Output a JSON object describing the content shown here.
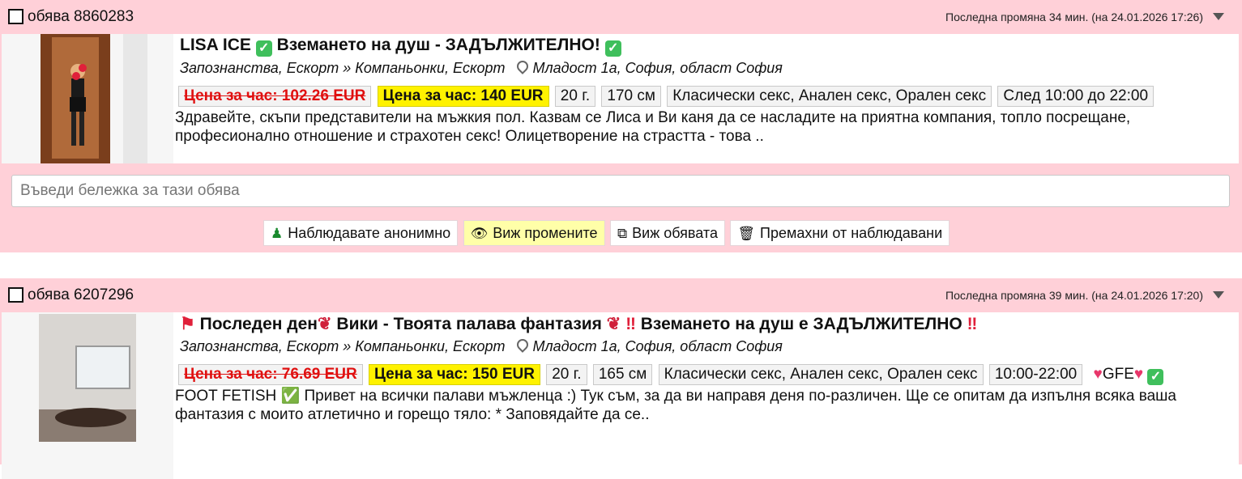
{
  "listings": [
    {
      "ad_id": "обява 8860283",
      "updated": "Последна промяна 34 мин. (на 24.01.2026 17:26)",
      "title_name": "LISA ICE",
      "title_rest": "Вземането на душ - ЗАДЪЛЖИТЕЛНО!",
      "category": "Запознанства, Ескорт » Компаньонки, Ескорт",
      "location": "Младост 1а, София, област София",
      "old_price": "Цена за час: 102.26 EUR",
      "new_price": "Цена за час: 140 EUR",
      "age": "20 г.",
      "height": "170 см",
      "services": "Класически секс, Анален секс, Орален секс",
      "hours": "След 10:00 до 22:00",
      "description": "Здравейте, скъпи представители на мъжкия пол. Казвам се Лиса и Ви каня да се насладите на приятна компания, топло посрещане, професионално отношение и страхотен секс! Олицетворение на страстта - това .."
    },
    {
      "ad_id": "обява 6207296",
      "updated": "Последна промяна 39 мин. (на 24.01.2026 17:20)",
      "title_text": "Последен ден",
      "title_name": "Вики - Твоята палава фантазия",
      "title_rest": "Вземането на душ е ЗАДЪЛЖИТЕЛНО",
      "category": "Запознанства, Ескорт » Компаньонки, Ескорт",
      "location": "Младост 1а, София, област София",
      "old_price": "Цена за час: 76.69 EUR",
      "new_price": "Цена за час: 150 EUR",
      "age": "20 г.",
      "height": "165 см",
      "services": "Класически секс, Анален секс, Орален секс",
      "hours": "10:00-22:00",
      "extra": "GFE",
      "description": "FOOT FETISH ✅ Привет на всички палави мъжленца :) Тук съм, за да ви направя деня по-различен. Ще се опитам да изпълня всяка ваша фантазия с моито атлетично и горещо тяло: * Заповядайте да се.."
    }
  ],
  "note": {
    "placeholder": "Въведи бележка за тази обява"
  },
  "actions": {
    "watching": "Наблюдавате анонимно",
    "view_changes": "Виж промените",
    "view_ad": "Виж обявата",
    "remove": "Премахни от наблюдавани"
  },
  "colors": {
    "card_bg": "#ffd0d8",
    "new_price_bg": "#fff200",
    "old_price": "#e01010",
    "check_green": "#3fbf5c"
  },
  "icons": [
    "checkbox-icon",
    "caret-down-icon",
    "checkmark-icon",
    "location-pin-icon",
    "flag-icon",
    "rose-icon",
    "exclamation-icon",
    "heart-icon",
    "incognito-icon",
    "eye-icon",
    "external-link-icon",
    "trash-icon"
  ]
}
